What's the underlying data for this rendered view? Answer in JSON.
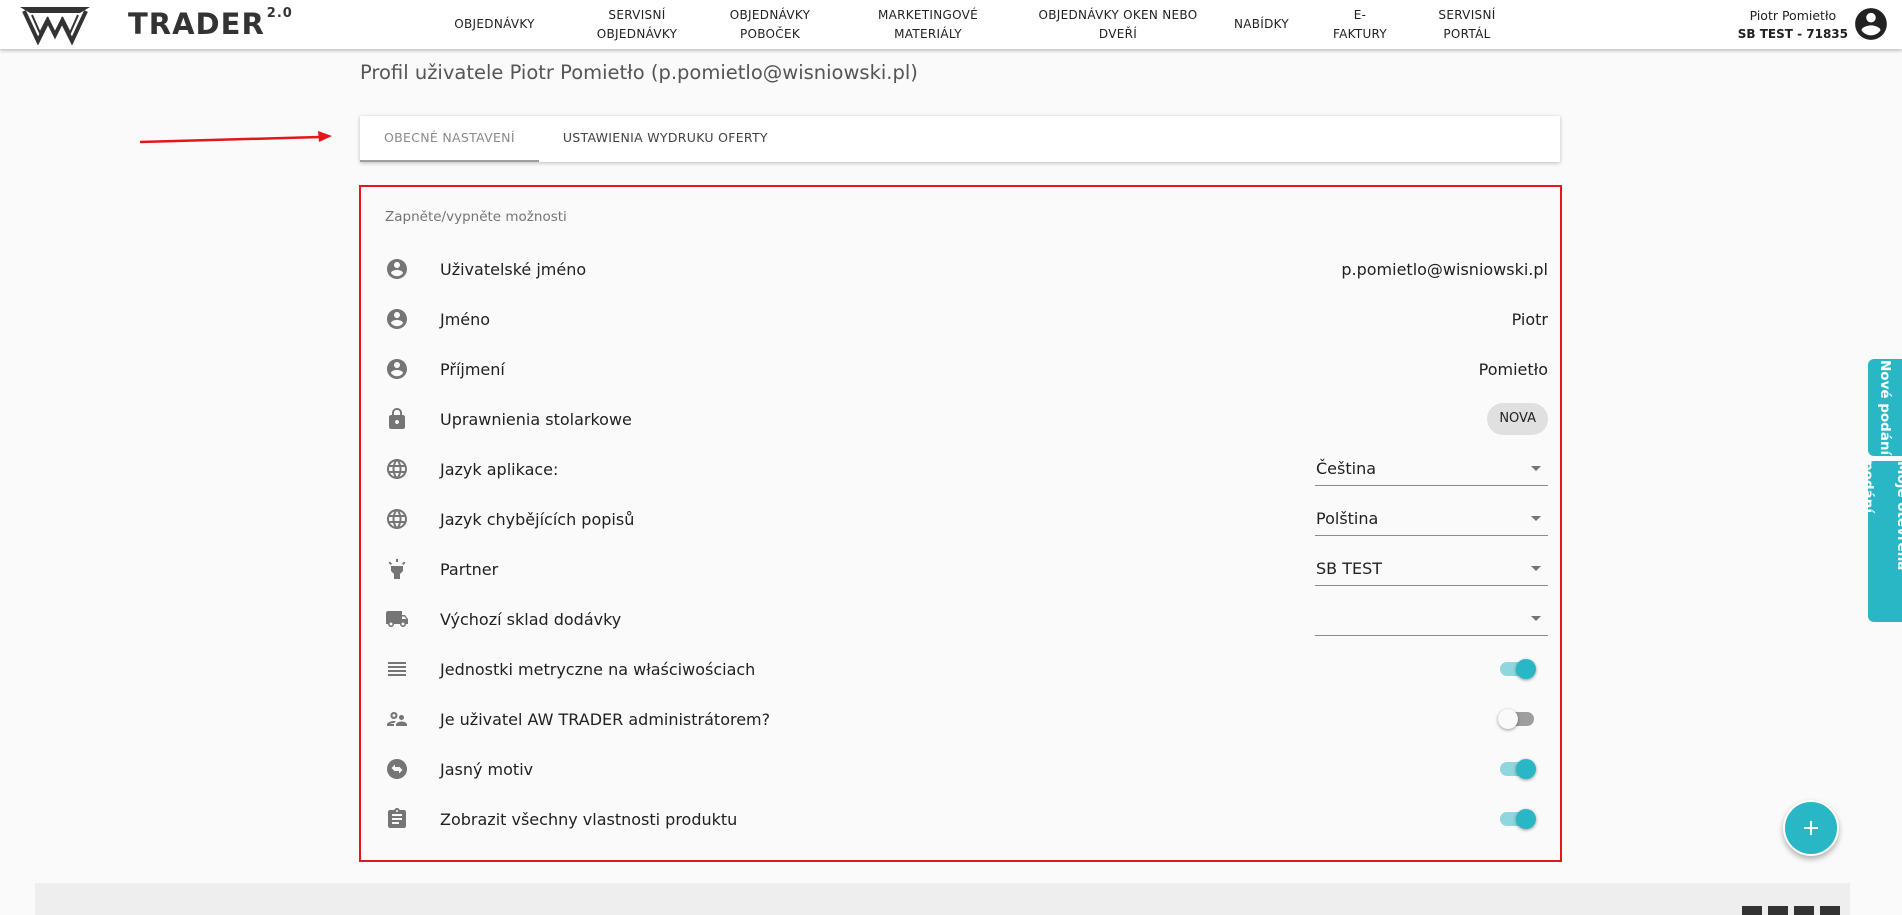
{
  "header": {
    "brand_name": "TRADER",
    "brand_version": "2.0",
    "nav": [
      {
        "label": "OBJEDNÁVKY"
      },
      {
        "label": "SERVISNÍ\nOBJEDNÁVKY"
      },
      {
        "label": "OBJEDNÁVKY\nPOBOČEK"
      },
      {
        "label": "MARKETINGOVÉ\nMATERIÁLY"
      },
      {
        "label": "OBJEDNÁVKY OKEN NEBO\nDVEŘÍ"
      },
      {
        "label": "NABÍDKY"
      },
      {
        "label": "E-\nFAKTURY"
      },
      {
        "label": "SERVISNÍ\nPORTÁL"
      }
    ],
    "user_name": "Piotr Pomietło",
    "user_company": "SB TEST - 71835"
  },
  "page": {
    "title": "Profil uživatele Piotr Pomietło (p.pomietlo@wisniowski.pl)"
  },
  "tabs": [
    {
      "label": "OBECNÉ NASTAVENÍ",
      "active": true
    },
    {
      "label": "USTAWIENIA WYDRUKU OFERTY",
      "active": false
    }
  ],
  "settings": {
    "header": "Zapněte/vypněte možnosti",
    "rows": [
      {
        "label": "Uživatelské jméno",
        "value": "p.pomietlo@wisniowski.pl",
        "icon": "account-circle-icon"
      },
      {
        "label": "Jméno",
        "value": "Piotr",
        "icon": "account-circle-icon"
      },
      {
        "label": "Příjmení",
        "value": "Pomietło",
        "icon": "account-circle-icon"
      },
      {
        "label": "Uprawnienia stolarkowe",
        "chip": "NOVA",
        "icon": "lock-icon"
      },
      {
        "label": "Jazyk aplikace:",
        "select": "Čeština",
        "icon": "globe-icon"
      },
      {
        "label": "Jazyk chybějících popisů",
        "select": "Polština",
        "icon": "globe-icon"
      },
      {
        "label": "Partner",
        "select": "SB TEST",
        "icon": "light-icon"
      },
      {
        "label": "Výchozí sklad dodávky",
        "select": "",
        "icon": "truck-icon"
      },
      {
        "label": "Jednostki metryczne na właściwościach",
        "toggle": true,
        "icon": "list-icon"
      },
      {
        "label": "Je uživatel AW TRADER administrátorem?",
        "toggle": false,
        "icon": "supervisor-icon"
      },
      {
        "label": "Jasný motiv",
        "toggle": true,
        "icon": "swap-icon"
      },
      {
        "label": "Zobrazit všechny vlastnosti produktu",
        "toggle": true,
        "icon": "clipboard-icon"
      }
    ]
  },
  "side_tabs": {
    "new_submission": "Nové podání",
    "my_open": "Moje otevřená podání"
  },
  "colors": {
    "accent": "#2ab7c5",
    "highlight_border": "#e3161c"
  }
}
